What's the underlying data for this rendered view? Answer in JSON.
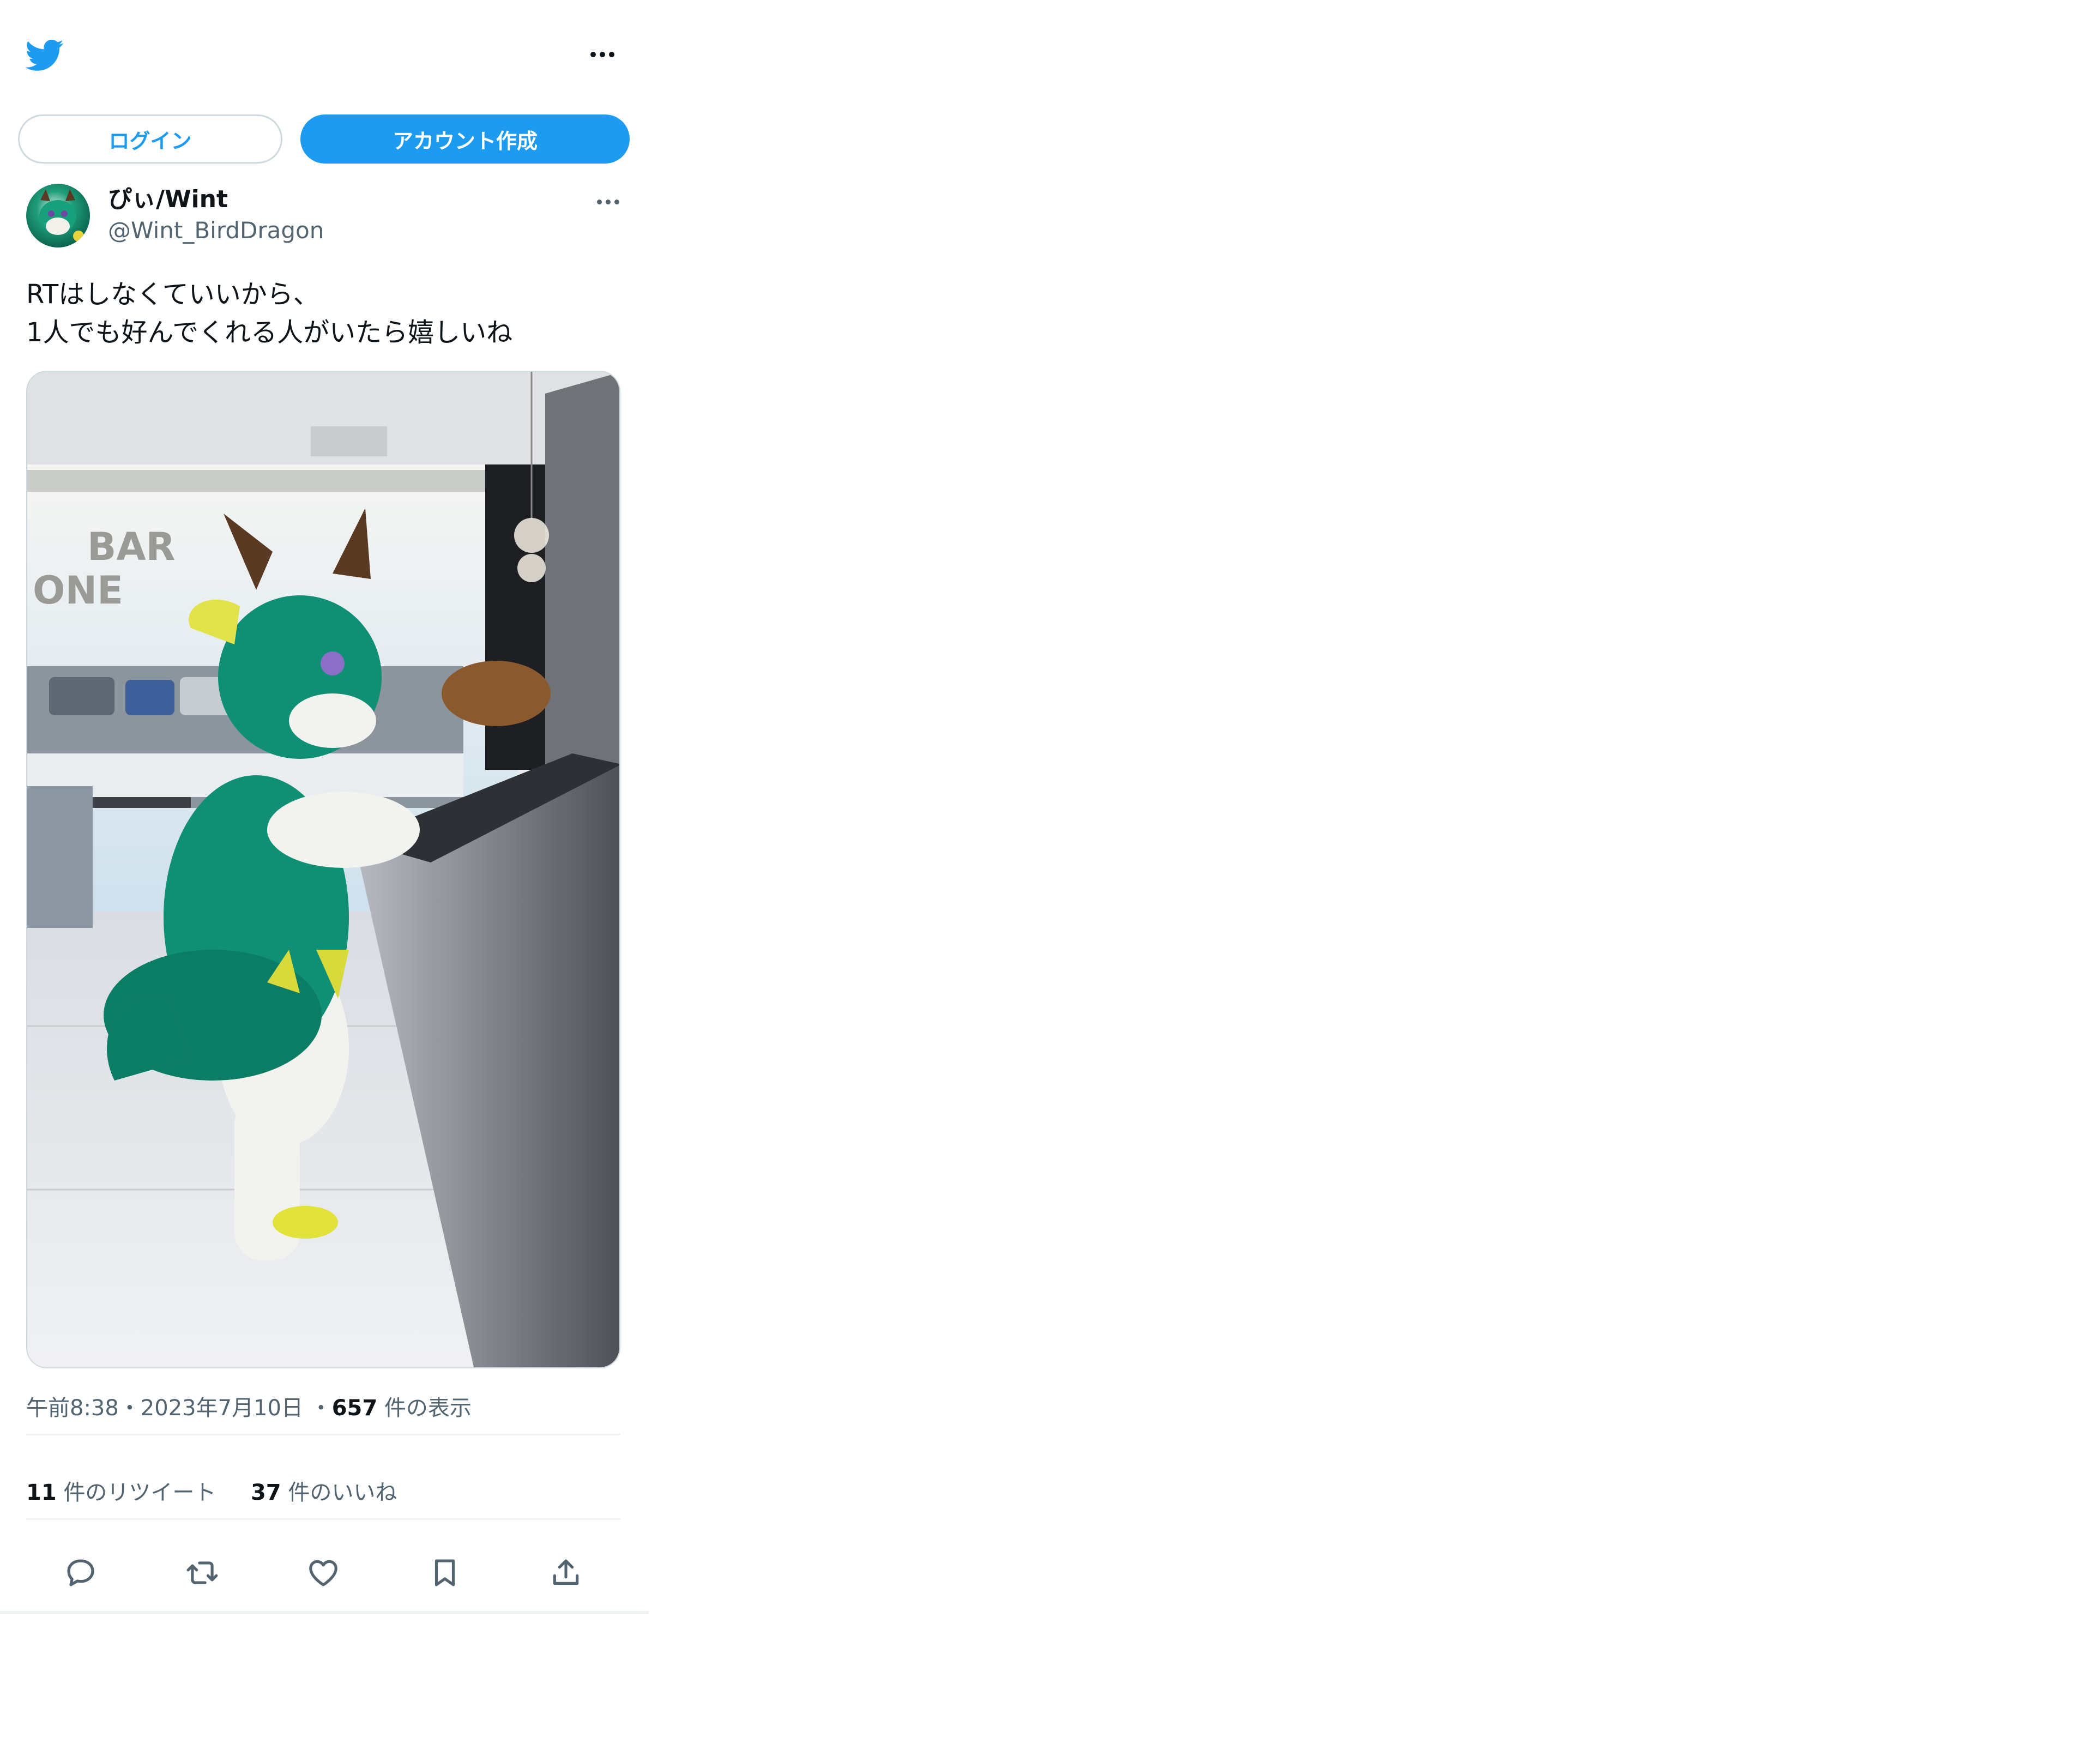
{
  "header": {
    "logo_icon": "twitter-bird-icon",
    "more_icon": "more-horizontal-icon"
  },
  "auth": {
    "login_label": "ログイン",
    "signup_label": "アカウント作成"
  },
  "tweet": {
    "author": {
      "display_name": "ぴぃ/Wint",
      "handle": "@Wint_BirdDragon",
      "avatar_icon": "avatar-image"
    },
    "text": "RTはしなくていいから、\n1人でも好んでくれる人がいたら嬉しいね",
    "media": {
      "sign_line1": "BAR",
      "sign_line2": "ONE"
    },
    "time": "午前8:38",
    "separator": "・",
    "date": "2023年7月10日",
    "views_count": "657",
    "views_label": "件の表示",
    "retweets_count": "11",
    "retweets_label": "件のリツイート",
    "likes_count": "37",
    "likes_label": "件のいいね"
  },
  "actions": [
    "reply-icon",
    "retweet-icon",
    "like-icon",
    "bookmark-icon",
    "share-icon"
  ],
  "colors": {
    "accent": "#1d9bf0",
    "text": "#0f1419",
    "secondary": "#536471",
    "border": "#cfd9de"
  }
}
